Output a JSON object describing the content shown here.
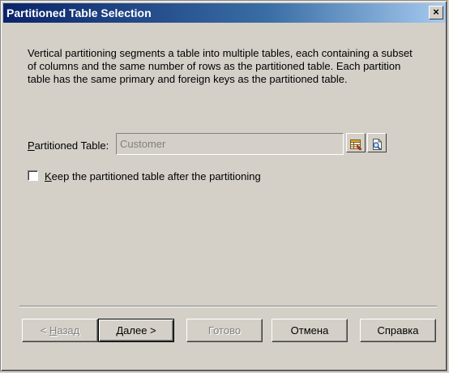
{
  "window": {
    "title": "Partitioned Table Selection",
    "close_glyph": "×"
  },
  "description": "Vertical partitioning segments a table into multiple tables, each containing a subset of columns and the same number of rows as the partitioned table. Each partition table has the same primary and foreign keys as the partitioned table.",
  "partitioned_table": {
    "label_hotkey": "P",
    "label_rest": "artitioned Table:",
    "value": "Customer"
  },
  "keep_option": {
    "checked": false,
    "label_hotkey": "K",
    "label_rest": "eep the partitioned table after the partitioning"
  },
  "buttons": {
    "back": {
      "prefix": "< ",
      "hotkey": "Н",
      "rest": "азад"
    },
    "next": {
      "hotkey": "Д",
      "rest": "алее >"
    },
    "finish": "Готово",
    "cancel": "Отмена",
    "help": "Справка"
  },
  "icons": {
    "select_table": "table-properties-icon",
    "browse": "browse-icon"
  }
}
